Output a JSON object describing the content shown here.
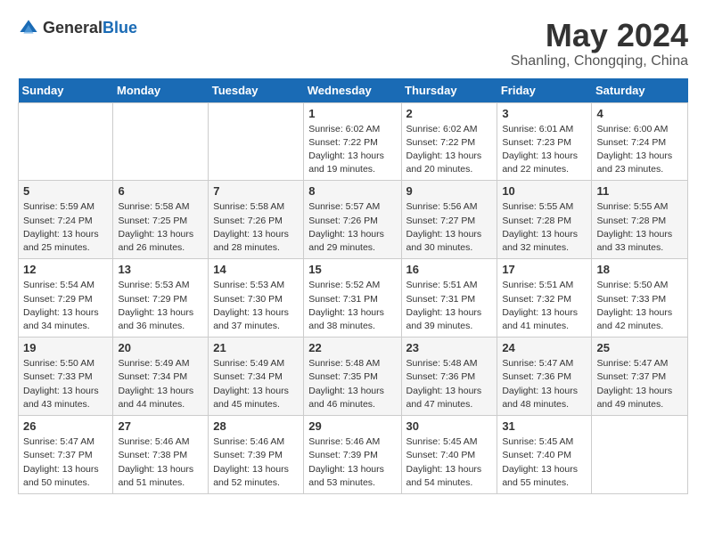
{
  "logo": {
    "general": "General",
    "blue": "Blue"
  },
  "header": {
    "month_year": "May 2024",
    "location": "Shanling, Chongqing, China"
  },
  "weekdays": [
    "Sunday",
    "Monday",
    "Tuesday",
    "Wednesday",
    "Thursday",
    "Friday",
    "Saturday"
  ],
  "weeks": [
    [
      {
        "day": "",
        "sunrise": "",
        "sunset": "",
        "daylight": ""
      },
      {
        "day": "",
        "sunrise": "",
        "sunset": "",
        "daylight": ""
      },
      {
        "day": "",
        "sunrise": "",
        "sunset": "",
        "daylight": ""
      },
      {
        "day": "1",
        "sunrise": "Sunrise: 6:02 AM",
        "sunset": "Sunset: 7:22 PM",
        "daylight": "Daylight: 13 hours and 19 minutes."
      },
      {
        "day": "2",
        "sunrise": "Sunrise: 6:02 AM",
        "sunset": "Sunset: 7:22 PM",
        "daylight": "Daylight: 13 hours and 20 minutes."
      },
      {
        "day": "3",
        "sunrise": "Sunrise: 6:01 AM",
        "sunset": "Sunset: 7:23 PM",
        "daylight": "Daylight: 13 hours and 22 minutes."
      },
      {
        "day": "4",
        "sunrise": "Sunrise: 6:00 AM",
        "sunset": "Sunset: 7:24 PM",
        "daylight": "Daylight: 13 hours and 23 minutes."
      }
    ],
    [
      {
        "day": "5",
        "sunrise": "Sunrise: 5:59 AM",
        "sunset": "Sunset: 7:24 PM",
        "daylight": "Daylight: 13 hours and 25 minutes."
      },
      {
        "day": "6",
        "sunrise": "Sunrise: 5:58 AM",
        "sunset": "Sunset: 7:25 PM",
        "daylight": "Daylight: 13 hours and 26 minutes."
      },
      {
        "day": "7",
        "sunrise": "Sunrise: 5:58 AM",
        "sunset": "Sunset: 7:26 PM",
        "daylight": "Daylight: 13 hours and 28 minutes."
      },
      {
        "day": "8",
        "sunrise": "Sunrise: 5:57 AM",
        "sunset": "Sunset: 7:26 PM",
        "daylight": "Daylight: 13 hours and 29 minutes."
      },
      {
        "day": "9",
        "sunrise": "Sunrise: 5:56 AM",
        "sunset": "Sunset: 7:27 PM",
        "daylight": "Daylight: 13 hours and 30 minutes."
      },
      {
        "day": "10",
        "sunrise": "Sunrise: 5:55 AM",
        "sunset": "Sunset: 7:28 PM",
        "daylight": "Daylight: 13 hours and 32 minutes."
      },
      {
        "day": "11",
        "sunrise": "Sunrise: 5:55 AM",
        "sunset": "Sunset: 7:28 PM",
        "daylight": "Daylight: 13 hours and 33 minutes."
      }
    ],
    [
      {
        "day": "12",
        "sunrise": "Sunrise: 5:54 AM",
        "sunset": "Sunset: 7:29 PM",
        "daylight": "Daylight: 13 hours and 34 minutes."
      },
      {
        "day": "13",
        "sunrise": "Sunrise: 5:53 AM",
        "sunset": "Sunset: 7:29 PM",
        "daylight": "Daylight: 13 hours and 36 minutes."
      },
      {
        "day": "14",
        "sunrise": "Sunrise: 5:53 AM",
        "sunset": "Sunset: 7:30 PM",
        "daylight": "Daylight: 13 hours and 37 minutes."
      },
      {
        "day": "15",
        "sunrise": "Sunrise: 5:52 AM",
        "sunset": "Sunset: 7:31 PM",
        "daylight": "Daylight: 13 hours and 38 minutes."
      },
      {
        "day": "16",
        "sunrise": "Sunrise: 5:51 AM",
        "sunset": "Sunset: 7:31 PM",
        "daylight": "Daylight: 13 hours and 39 minutes."
      },
      {
        "day": "17",
        "sunrise": "Sunrise: 5:51 AM",
        "sunset": "Sunset: 7:32 PM",
        "daylight": "Daylight: 13 hours and 41 minutes."
      },
      {
        "day": "18",
        "sunrise": "Sunrise: 5:50 AM",
        "sunset": "Sunset: 7:33 PM",
        "daylight": "Daylight: 13 hours and 42 minutes."
      }
    ],
    [
      {
        "day": "19",
        "sunrise": "Sunrise: 5:50 AM",
        "sunset": "Sunset: 7:33 PM",
        "daylight": "Daylight: 13 hours and 43 minutes."
      },
      {
        "day": "20",
        "sunrise": "Sunrise: 5:49 AM",
        "sunset": "Sunset: 7:34 PM",
        "daylight": "Daylight: 13 hours and 44 minutes."
      },
      {
        "day": "21",
        "sunrise": "Sunrise: 5:49 AM",
        "sunset": "Sunset: 7:34 PM",
        "daylight": "Daylight: 13 hours and 45 minutes."
      },
      {
        "day": "22",
        "sunrise": "Sunrise: 5:48 AM",
        "sunset": "Sunset: 7:35 PM",
        "daylight": "Daylight: 13 hours and 46 minutes."
      },
      {
        "day": "23",
        "sunrise": "Sunrise: 5:48 AM",
        "sunset": "Sunset: 7:36 PM",
        "daylight": "Daylight: 13 hours and 47 minutes."
      },
      {
        "day": "24",
        "sunrise": "Sunrise: 5:47 AM",
        "sunset": "Sunset: 7:36 PM",
        "daylight": "Daylight: 13 hours and 48 minutes."
      },
      {
        "day": "25",
        "sunrise": "Sunrise: 5:47 AM",
        "sunset": "Sunset: 7:37 PM",
        "daylight": "Daylight: 13 hours and 49 minutes."
      }
    ],
    [
      {
        "day": "26",
        "sunrise": "Sunrise: 5:47 AM",
        "sunset": "Sunset: 7:37 PM",
        "daylight": "Daylight: 13 hours and 50 minutes."
      },
      {
        "day": "27",
        "sunrise": "Sunrise: 5:46 AM",
        "sunset": "Sunset: 7:38 PM",
        "daylight": "Daylight: 13 hours and 51 minutes."
      },
      {
        "day": "28",
        "sunrise": "Sunrise: 5:46 AM",
        "sunset": "Sunset: 7:39 PM",
        "daylight": "Daylight: 13 hours and 52 minutes."
      },
      {
        "day": "29",
        "sunrise": "Sunrise: 5:46 AM",
        "sunset": "Sunset: 7:39 PM",
        "daylight": "Daylight: 13 hours and 53 minutes."
      },
      {
        "day": "30",
        "sunrise": "Sunrise: 5:45 AM",
        "sunset": "Sunset: 7:40 PM",
        "daylight": "Daylight: 13 hours and 54 minutes."
      },
      {
        "day": "31",
        "sunrise": "Sunrise: 5:45 AM",
        "sunset": "Sunset: 7:40 PM",
        "daylight": "Daylight: 13 hours and 55 minutes."
      },
      {
        "day": "",
        "sunrise": "",
        "sunset": "",
        "daylight": ""
      }
    ]
  ]
}
